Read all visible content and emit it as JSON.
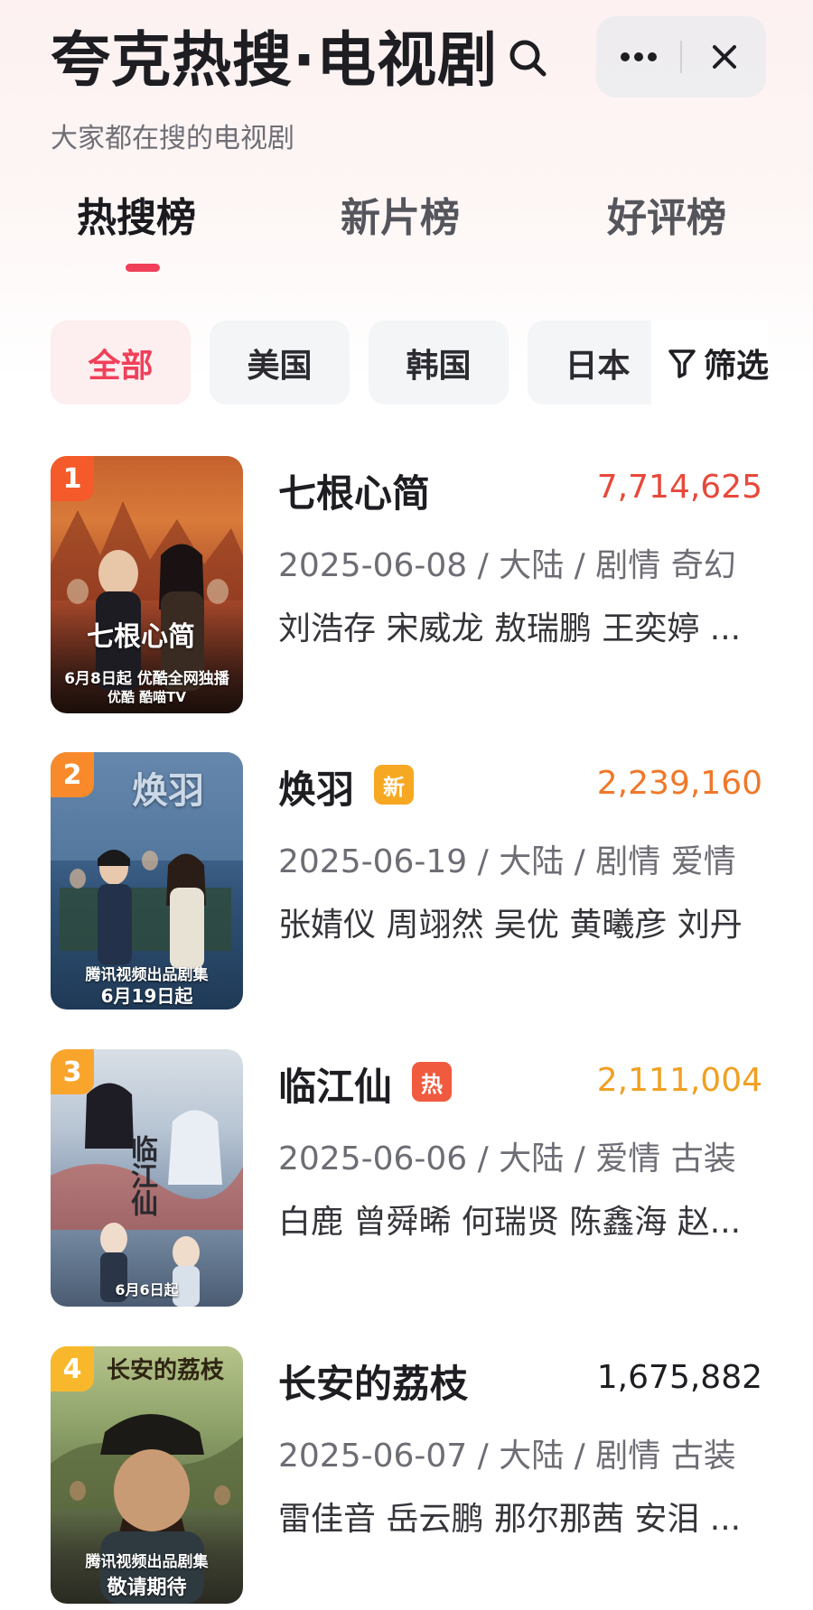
{
  "header": {
    "title": "夸克热搜·电视剧",
    "subtitle": "大家都在搜的电视剧",
    "search_icon": "search-icon",
    "more_icon": "more-icon",
    "close_icon": "close-icon"
  },
  "tabs": [
    {
      "label": "热搜榜",
      "active": true
    },
    {
      "label": "新片榜",
      "active": false
    },
    {
      "label": "好评榜",
      "active": false
    }
  ],
  "filters": {
    "chips": [
      {
        "label": "全部",
        "active": true
      },
      {
        "label": "美国",
        "active": false
      },
      {
        "label": "韩国",
        "active": false
      },
      {
        "label": "日本",
        "active": false
      }
    ],
    "filter_label": "筛选"
  },
  "list": [
    {
      "rank": "1",
      "title": "七根心简",
      "badge": "",
      "heat": "7,714,625",
      "meta": "2025-06-08 / 大陆 / 剧情 奇幻",
      "cast": "刘浩存 宋威龙 敖瑞鹏 王奕婷 ...",
      "poster_art": "七根心简",
      "poster_caption": "6月8日起 优酷全网独播",
      "poster_caption2": "优酷  酷喵TV"
    },
    {
      "rank": "2",
      "title": "焕羽",
      "badge": "新",
      "heat": "2,239,160",
      "meta": "2025-06-19 / 大陆 / 剧情 爱情",
      "cast": "张婧仪 周翊然 吴优 黄曦彦 刘丹",
      "poster_art": "焕羽",
      "poster_caption": "腾讯视频出品剧集",
      "poster_caption2": "6月19日起"
    },
    {
      "rank": "3",
      "title": "临江仙",
      "badge": "热",
      "heat": "2,111,004",
      "meta": "2025-06-06 / 大陆 / 爱情 古装",
      "cast": "白鹿 曾舜晞 何瑞贤 陈鑫海 赵...",
      "poster_art": "临江仙",
      "poster_caption": "",
      "poster_caption2": "6月6日起"
    },
    {
      "rank": "4",
      "title": "长安的荔枝",
      "badge": "",
      "heat": "1,675,882",
      "meta": "2025-06-07 / 大陆 / 剧情 古装",
      "cast": "雷佳音 岳云鹏 那尔那茜 安泪 ...",
      "poster_art": "长安的荔枝",
      "poster_caption": "腾讯视频出品剧集",
      "poster_caption2": "敬请期待"
    }
  ],
  "colors": {
    "accent": "#f0405a",
    "rank1": "#f45a2a",
    "rank2": "#f98a2c",
    "rank3": "#f9a52c",
    "rank4": "#f9b82c",
    "heat1": "#e8483a",
    "heat2": "#f0782a",
    "heat3": "#f0a022",
    "heat4": "#1d1d22",
    "badge_new": "#f7a823",
    "badge_hot": "#f05a3e"
  }
}
